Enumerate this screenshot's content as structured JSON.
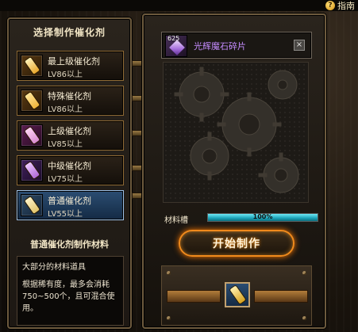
{
  "help": {
    "icon": "question-mark-icon",
    "label": "指南"
  },
  "left_panel": {
    "title": "选择制作催化剂",
    "items": [
      {
        "name": "最上级催化剂",
        "level": "LV86以上",
        "icon_color": "#e7a62c",
        "icon": "catalyst-bottle-icon"
      },
      {
        "name": "特殊催化剂",
        "level": "LV86以上",
        "icon_color": "#f0b53a",
        "icon": "catalyst-bottle-icon"
      },
      {
        "name": "上级催化剂",
        "level": "LV85以上",
        "icon_color": "#d88bd0",
        "icon": "catalyst-bottle-icon"
      },
      {
        "name": "中级催化剂",
        "level": "LV75以上",
        "icon_color": "#b06ad6",
        "icon": "catalyst-bottle-icon"
      },
      {
        "name": "普通催化剂",
        "level": "LV55以上",
        "icon_color": "#e2c46a",
        "icon": "catalyst-bottle-icon",
        "corner": ""
      }
    ],
    "subtitle": "普通催化剂制作材料",
    "description_line1": "大部分的材料道具",
    "description_line2": "根据稀有度，最多会消耗750~500个，且可混合使用。"
  },
  "material": {
    "count": "625",
    "name": "光辉魔石碎片",
    "icon": "crystal-shard-icon",
    "close": "×"
  },
  "progress": {
    "label": "材料槽",
    "value_text": "100%",
    "fill_fraction": 1.0
  },
  "start_button": {
    "label": "开始制作"
  },
  "colors": {
    "accent_orange": "#f08a1c",
    "selected_blue": "#2b4d72",
    "material_purple": "#c58cff",
    "progress_cyan": "#1aa2b7"
  }
}
